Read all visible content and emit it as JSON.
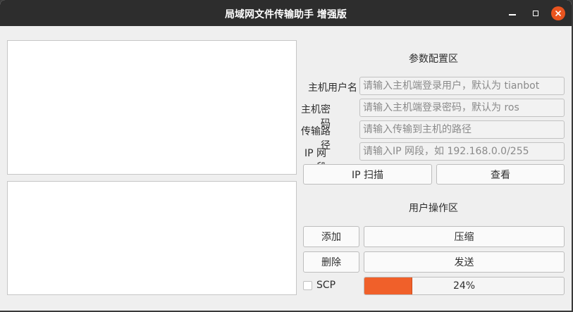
{
  "window": {
    "title": "局域网文件传输助手  增强版"
  },
  "titlebar": {
    "minimize_icon": "minimize-icon",
    "maximize_icon": "maximize-icon",
    "close_icon": "close-icon",
    "close_color": "#e9541f"
  },
  "params": {
    "section_title": "参数配置区",
    "fields": [
      {
        "label": "主机用户名",
        "placeholder": "请输入主机端登录用户，默认为 tianbot",
        "value": ""
      },
      {
        "label": "主机密码",
        "placeholder": "请输入主机端登录密码，默认为 ros",
        "value": ""
      },
      {
        "label": "传输路径",
        "placeholder": "请输入传输到主机的路径",
        "value": ""
      },
      {
        "label": "IP 网段",
        "placeholder": "请输入IP 网段，如 192.168.0.0/255",
        "value": ""
      }
    ],
    "scan_button": "IP 扫描",
    "view_button": "查看"
  },
  "ops": {
    "section_title": "用户操作区",
    "add_button": "添加",
    "compress_button": "压缩",
    "delete_button": "删除",
    "send_button": "发送",
    "scp_label": "SCP",
    "scp_checked": false,
    "progress_value": 0.24,
    "progress_text": "24%",
    "progress_color": "#f0602a"
  }
}
